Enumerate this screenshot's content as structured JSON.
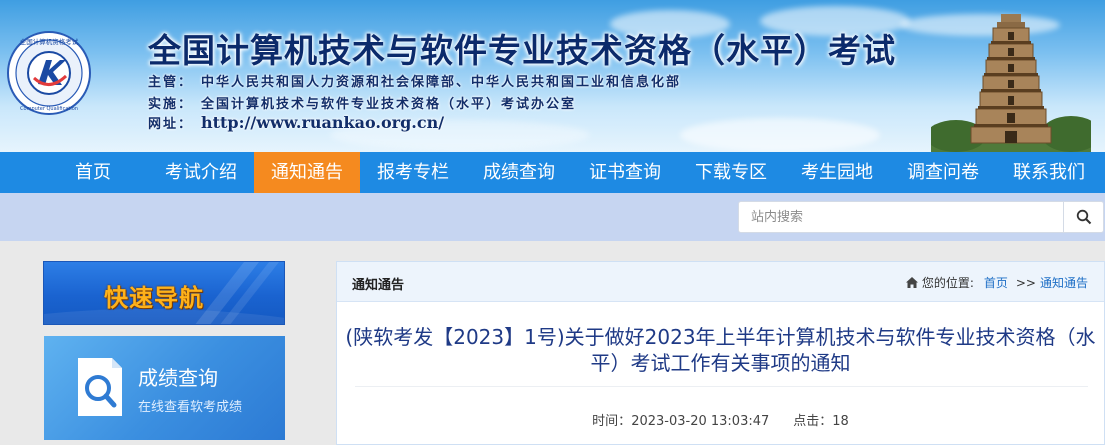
{
  "header": {
    "logo_name": "exam-logo",
    "title": "全国计算机技术与软件专业技术资格（水平）考试",
    "organizer_label": "主管：",
    "organizer": "中华人民共和国人力资源和社会保障部、中华人民共和国工业和信息化部",
    "implementer_label": "实施：",
    "implementer": "全国计算机技术与软件专业技术资格（水平）考试办公室",
    "url_label": "网址：",
    "url": "http://www.ruankao.org.cn/"
  },
  "nav": {
    "items": [
      {
        "label": "首页",
        "width": 110
      },
      {
        "label": "考试介绍",
        "width": 106
      },
      {
        "label": "通知通告",
        "width": 106
      },
      {
        "label": "报考专栏",
        "width": 106
      },
      {
        "label": "成绩查询",
        "width": 106
      },
      {
        "label": "证书查询",
        "width": 106
      },
      {
        "label": "下载专区",
        "width": 106
      },
      {
        "label": "考生园地",
        "width": 106
      },
      {
        "label": "调查问卷",
        "width": 106
      },
      {
        "label": "联系我们",
        "width": 106
      }
    ],
    "active": "通知通告"
  },
  "search": {
    "placeholder": "站内搜索",
    "icon": "search-icon"
  },
  "sidebar": {
    "quick_nav_label": "快速导航",
    "score": {
      "title": "成绩查询",
      "subtitle": "在线查看软考成绩",
      "icon": "magnifier-icon"
    }
  },
  "panel": {
    "heading": "通知通告",
    "breadcrumb": {
      "prefix": "您的位置:",
      "home": "首页",
      "separator": ">>",
      "current": "通知通告"
    },
    "article": {
      "title": "(陕软考发【2023】1号)关于做好2023年上半年计算机技术与软件专业技术资格（水平）考试工作有关事项的通知",
      "time_label": "时间：",
      "time": "2023-03-20 13:03:47",
      "clicks_label": "点击：",
      "clicks": "18"
    }
  },
  "colors": {
    "nav_bg": "#1e8ae3",
    "nav_active": "#f58a1f",
    "search_strip": "#c6d5f1",
    "title_blue": "#1f3a86",
    "link_blue": "#1f6fc6"
  }
}
